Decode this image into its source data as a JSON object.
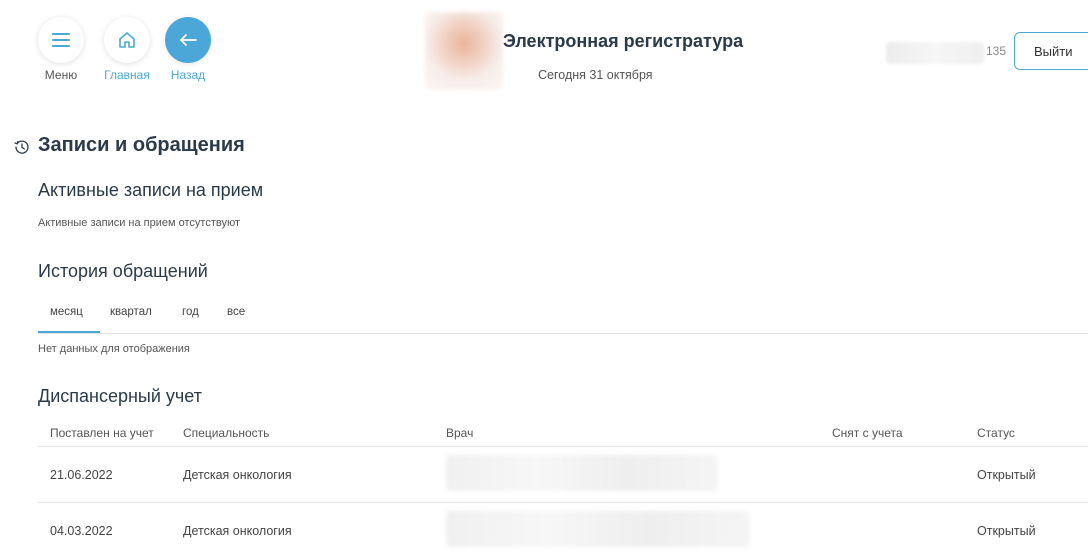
{
  "header": {
    "nav": [
      {
        "label": "Меню",
        "icon": "menu-icon"
      },
      {
        "label": "Главная",
        "icon": "home-icon"
      },
      {
        "label": "Назад",
        "icon": "arrow-left-icon"
      }
    ],
    "title": "Электронная регистратура",
    "date": "Сегодня 31 октября",
    "user_suffix": "135",
    "logout_label": "Выйти"
  },
  "main": {
    "section_title": "Записи и обращения",
    "active": {
      "title": "Активные записи на прием",
      "empty": "Активные записи на прием отсутствуют"
    },
    "history": {
      "title": "История обращений",
      "tabs": [
        "месяц",
        "квартал",
        "год",
        "все"
      ],
      "empty": "Нет данных для отображения"
    },
    "dispensary": {
      "title": "Диспансерный учет",
      "columns": [
        "Поставлен на учет",
        "Специальность",
        "Врач",
        "Снят с учета",
        "Статус"
      ],
      "rows": [
        {
          "registered": "21.06.2022",
          "specialty": "Детская онкология",
          "removed": "",
          "status": "Открытый"
        },
        {
          "registered": "04.03.2022",
          "specialty": "Детская онкология",
          "removed": "",
          "status": "Открытый"
        }
      ]
    }
  },
  "colors": {
    "accent": "#4aa7d8",
    "heading": "#2b3a4a"
  }
}
